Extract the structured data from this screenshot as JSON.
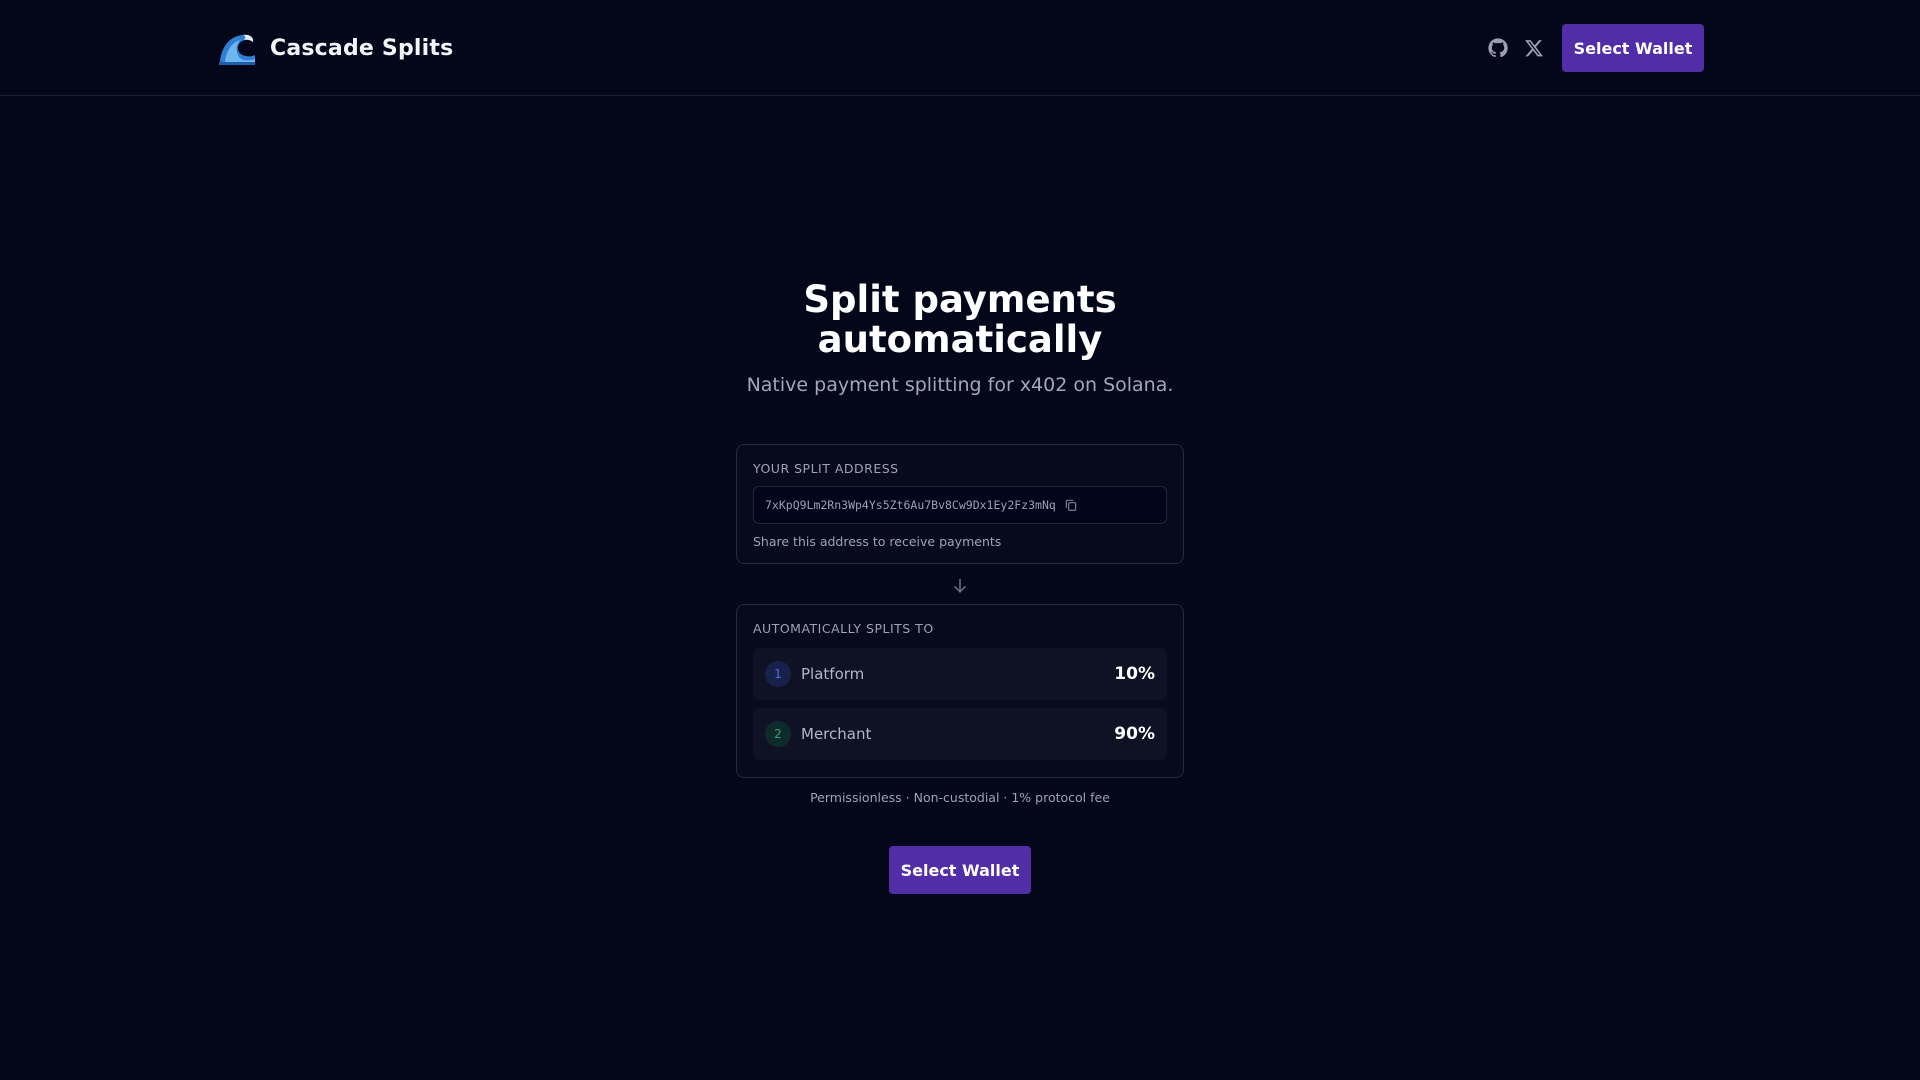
{
  "header": {
    "brand_name": "Cascade Splits",
    "wallet_button": "Select Wallet"
  },
  "icons": {
    "logo": "wave-logo",
    "github": "github-icon",
    "x": "x-icon",
    "copy": "copy-icon",
    "arrow": "arrow-down-icon"
  },
  "hero": {
    "title": "Split payments automatically",
    "subtitle": "Native payment splitting for x402 on Solana."
  },
  "address_card": {
    "label": "YOUR SPLIT ADDRESS",
    "address": "7xKpQ9Lm2Rn3Wp4Ys5Zt6Au7Bv8Cw9Dx1Ey2Fz3mNq",
    "hint": "Share this address to receive payments"
  },
  "splits_card": {
    "label": "AUTOMATICALLY SPLITS TO",
    "items": [
      {
        "index": "1",
        "name": "Platform",
        "percent": "10%"
      },
      {
        "index": "2",
        "name": "Merchant",
        "percent": "90%"
      }
    ]
  },
  "footnote": "Permissionless · Non-custodial · 1% protocol fee",
  "cta": {
    "wallet_button": "Select Wallet"
  },
  "colors": {
    "background": "#04061a",
    "accent": "#512da8",
    "index_blue": "#4f6de0",
    "index_green": "#27a86f"
  }
}
